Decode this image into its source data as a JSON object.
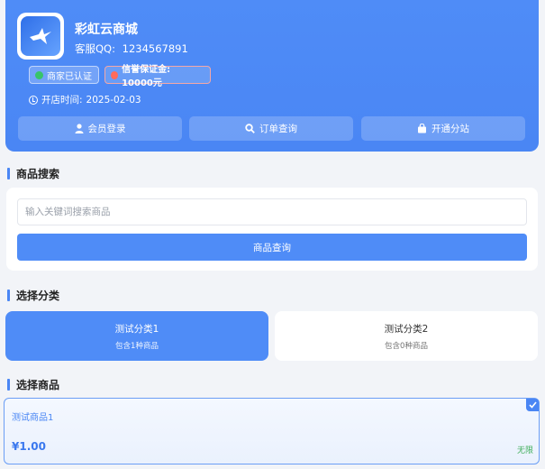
{
  "store": {
    "name": "彩虹云商城",
    "qq_label": "客服QQ:",
    "qq_value": "1234567891",
    "badge_certified": "商家已认证",
    "badge_deposit": "信誉保证金: 10000元",
    "open_date_label": "开店时间:",
    "open_date_value": "2025-02-03",
    "actions": [
      {
        "label": "会员登录",
        "icon": "user-icon"
      },
      {
        "label": "订单查询",
        "icon": "search-icon"
      },
      {
        "label": "开通分站",
        "icon": "shopping-bag-icon"
      }
    ]
  },
  "search_section": {
    "title": "商品搜索",
    "placeholder": "输入关键词搜索商品",
    "button": "商品查询"
  },
  "category_section": {
    "title": "选择分类",
    "categories": [
      {
        "name": "测试分类1",
        "count": "包含1种商品",
        "selected": true
      },
      {
        "name": "测试分类2",
        "count": "包含0种商品",
        "selected": false
      }
    ]
  },
  "product_section": {
    "title": "选择商品",
    "products": [
      {
        "name": "测试商品1",
        "price": "¥1.00",
        "stock": "无限",
        "selected": true
      }
    ]
  },
  "colors": {
    "primary": "#4f8cf7",
    "background": "#f2f4f8",
    "stock_green": "#3fae5b"
  }
}
